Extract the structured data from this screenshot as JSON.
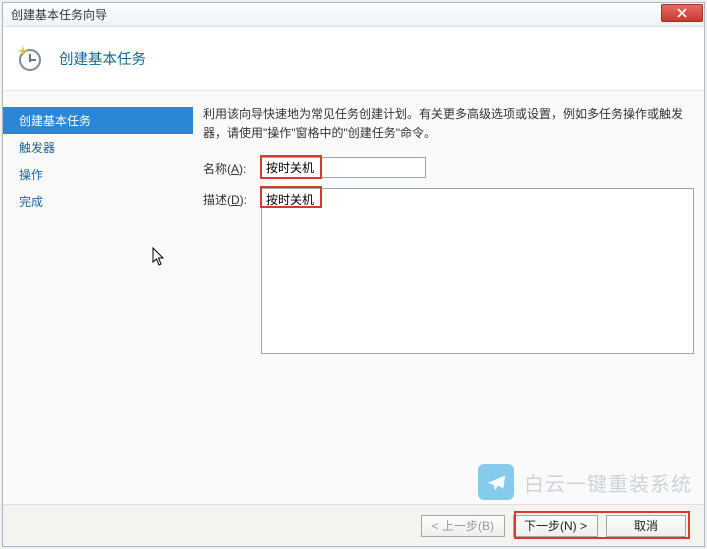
{
  "window": {
    "title": "创建基本任务向导"
  },
  "banner": {
    "heading": "创建基本任务"
  },
  "sidebar": {
    "items": [
      {
        "label": "创建基本任务",
        "selected": true
      },
      {
        "label": "触发器",
        "selected": false
      },
      {
        "label": "操作",
        "selected": false
      },
      {
        "label": "完成",
        "selected": false
      }
    ]
  },
  "content": {
    "intro": "利用该向导快速地为常见任务创建计划。有关更多高级选项或设置，例如多任务操作或触发器，请使用\"操作\"窗格中的\"创建任务\"命令。",
    "name_label_pre": "名称(",
    "name_hotkey": "A",
    "name_label_post": "):",
    "name_value": "按时关机",
    "desc_label_pre": "描述(",
    "desc_hotkey": "D",
    "desc_label_post": "):",
    "desc_value": "按时关机"
  },
  "footer": {
    "back": "< 上一步(B)",
    "next": "下一步(N) >",
    "cancel": "取消"
  },
  "watermark": {
    "text": "白云一键重装系统"
  },
  "colors": {
    "accent": "#2a86d6",
    "link": "#1566a0",
    "highlight": "#d83a2e"
  }
}
